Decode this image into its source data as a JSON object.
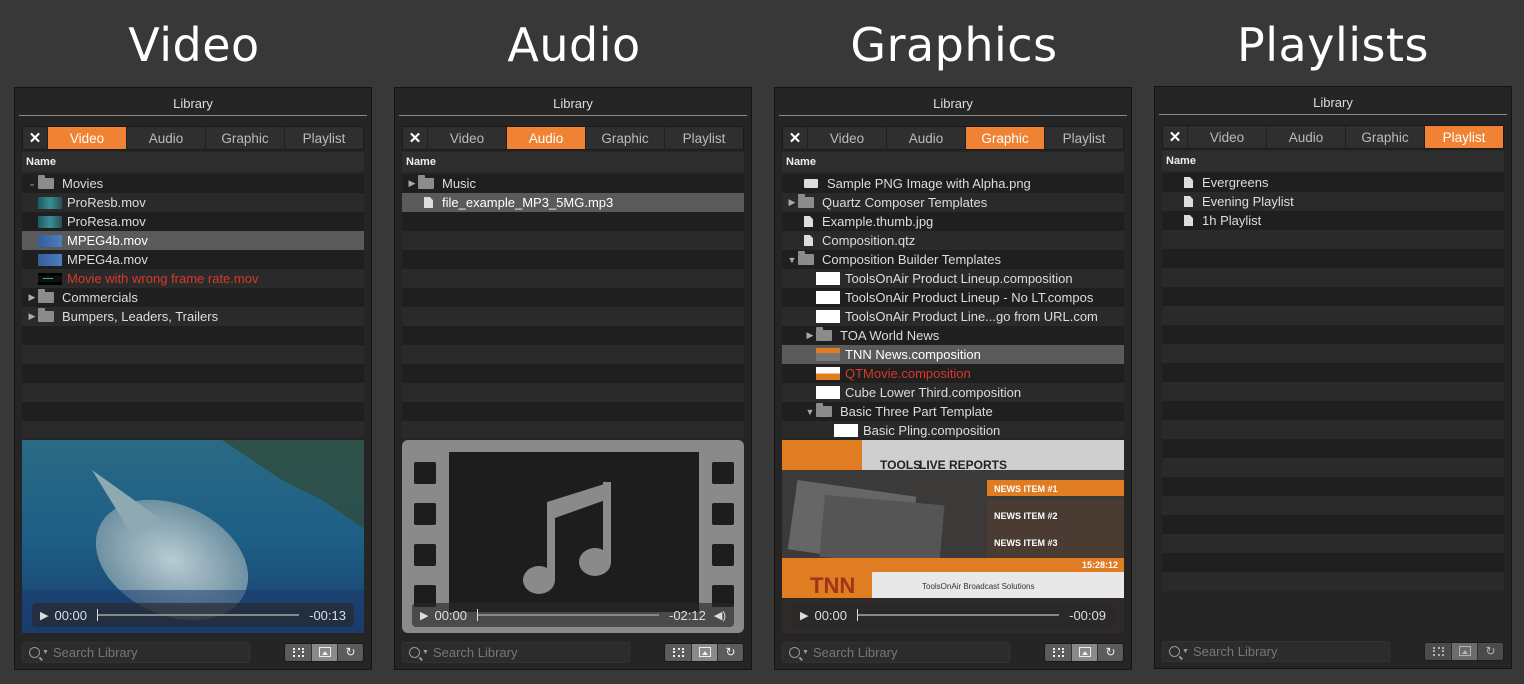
{
  "headings": [
    "Video",
    "Audio",
    "Graphics",
    "Playlists"
  ],
  "library_title": "Library",
  "tab_close": "✕",
  "tabs": [
    "Video",
    "Audio",
    "Graphic",
    "Playlist"
  ],
  "column_name": "Name",
  "search_placeholder": "Search Library",
  "colors": {
    "accent": "#ef8333",
    "error": "#d8392a",
    "panel": "#252525",
    "background": "#383838"
  },
  "video": {
    "active_tab": "Video",
    "rows": [
      {
        "label": "Movies",
        "icon": "folder-icon",
        "arrow": "⌄"
      },
      {
        "label": "ProResb.mov",
        "icon": "video-thumbnail"
      },
      {
        "label": "ProResa.mov",
        "icon": "video-thumbnail"
      },
      {
        "label": "MPEG4b.mov",
        "icon": "video-thumbnail",
        "selected": true
      },
      {
        "label": "MPEG4a.mov",
        "icon": "video-thumbnail"
      },
      {
        "label": "Movie with wrong frame rate.mov",
        "icon": "video-thumbnail",
        "error": true
      },
      {
        "label": "Commercials",
        "icon": "folder-icon",
        "arrow": "▶"
      },
      {
        "label": "Bumpers, Leaders, Trailers",
        "icon": "folder-icon",
        "arrow": "▶"
      }
    ],
    "time_current": "00:00",
    "time_remaining": "-00:13"
  },
  "audio": {
    "active_tab": "Audio",
    "rows": [
      {
        "label": "Music",
        "icon": "folder-icon",
        "arrow": "▶"
      },
      {
        "label": "file_example_MP3_5MG.mp3",
        "icon": "document-icon",
        "selected": true
      }
    ],
    "time_current": "00:00",
    "time_remaining": "-02:12"
  },
  "graphics": {
    "active_tab": "Graphic",
    "rows": [
      {
        "label": "Sample PNG Image with Alpha.png",
        "icon": "image-icon"
      },
      {
        "label": "Quartz Composer Templates",
        "icon": "folder-icon",
        "arrow": "▶"
      },
      {
        "label": "Example.thumb.jpg",
        "icon": "document-icon"
      },
      {
        "label": "Composition.qtz",
        "icon": "document-icon"
      },
      {
        "label": "Composition Builder Templates",
        "icon": "folder-icon",
        "arrow": "▼"
      },
      {
        "label": "ToolsOnAir Product Lineup.composition",
        "icon": "composition-thumbnail",
        "indent": 1
      },
      {
        "label": "ToolsOnAir Product Lineup - No LT.compos",
        "icon": "composition-thumbnail",
        "indent": 1
      },
      {
        "label": "ToolsOnAir Product Line...go from URL.com",
        "icon": "composition-thumbnail",
        "indent": 1
      },
      {
        "label": "TOA World News",
        "icon": "folder-icon",
        "arrow": "▶",
        "indent": 1
      },
      {
        "label": "TNN News.composition",
        "icon": "tnn-thumbnail",
        "indent": 1,
        "selected": true
      },
      {
        "label": "QTMovie.composition",
        "icon": "qt-thumbnail",
        "indent": 1,
        "error": true
      },
      {
        "label": "Cube Lower Third.composition",
        "icon": "composition-thumbnail",
        "indent": 1
      },
      {
        "label": "Basic Three Part Template",
        "icon": "folder-icon",
        "arrow": "▼",
        "indent": 1
      },
      {
        "label": "Basic Pling.composition",
        "icon": "composition-thumbnail",
        "indent": 2
      }
    ],
    "preview": {
      "brand": "TOOLS",
      "live": "LIVE REPORTS",
      "news_items": [
        "NEWS ITEM #1",
        "NEWS ITEM #2",
        "NEWS ITEM #3"
      ],
      "clock": "15:28:12",
      "logo": "TNN",
      "ticker": "ToolsOnAir Broadcast Solutions"
    },
    "time_current": "00:00",
    "time_remaining": "-00:09"
  },
  "playlists": {
    "active_tab": "Playlist",
    "rows": [
      {
        "label": "Evergreens",
        "icon": "playlist-document-icon"
      },
      {
        "label": "Evening Playlist",
        "icon": "playlist-document-icon"
      },
      {
        "label": "1h Playlist",
        "icon": "playlist-document-icon"
      }
    ]
  }
}
